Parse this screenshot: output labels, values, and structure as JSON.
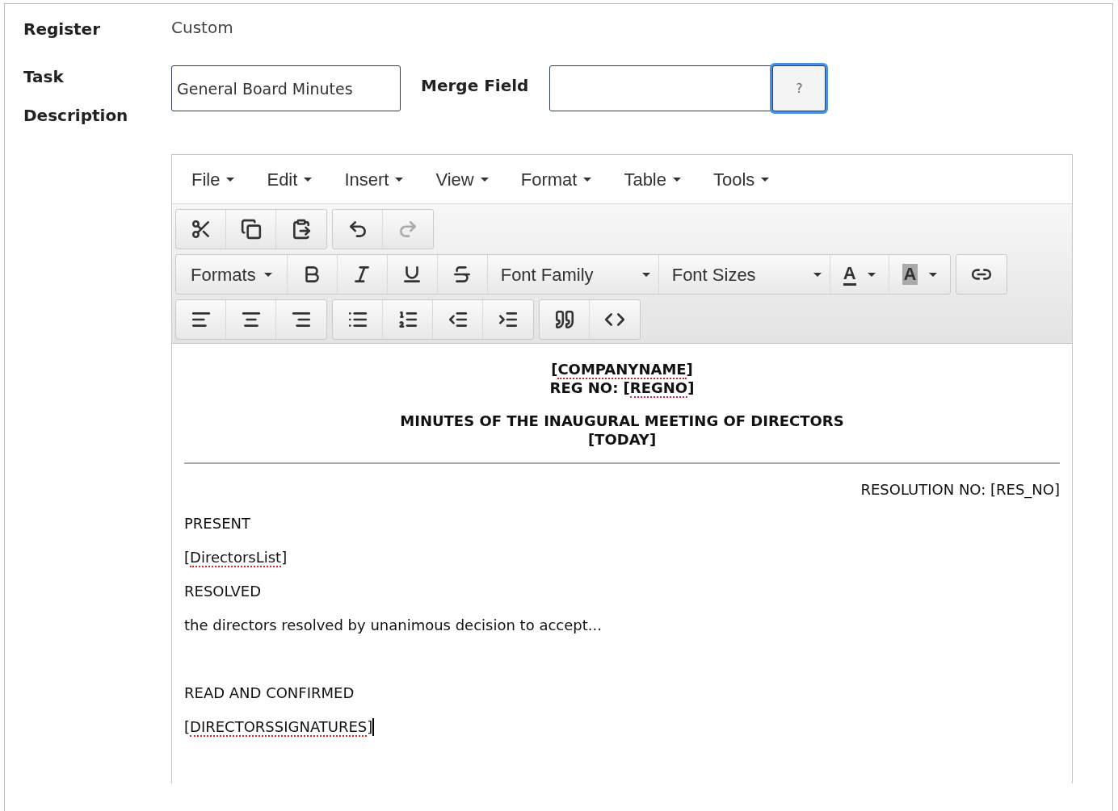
{
  "form": {
    "register_label": "Register",
    "register_value": "Custom",
    "task_label": "Task Description",
    "task_value": "General Board Minutes",
    "merge_label": "Merge Field",
    "merge_help": {
      "label": "?",
      "focused": true
    }
  },
  "editor": {
    "menus": [
      "File",
      "Edit",
      "Insert",
      "View",
      "Format",
      "Table",
      "Tools"
    ],
    "toolbar": [
      {
        "groups": [
          {
            "buttons": [
              {
                "kind": "icon",
                "disabled": false
              },
              {
                "kind": "icon",
                "disabled": false
              },
              {
                "kind": "icon",
                "disabled": false
              }
            ]
          },
          {
            "buttons": [
              {
                "kind": "icon",
                "disabled": false
              },
              {
                "kind": "icon",
                "disabled": true
              }
            ]
          }
        ]
      },
      {
        "groups": [
          {
            "buttons": [
              {
                "kind": "dropdown",
                "label": "Formats"
              },
              {
                "kind": "icon",
                "disabled": false
              },
              {
                "kind": "icon",
                "disabled": false
              },
              {
                "kind": "icon",
                "disabled": false
              },
              {
                "kind": "icon",
                "disabled": false
              },
              {
                "kind": "wide-dropdown",
                "label": "Font Family"
              },
              {
                "kind": "wide-dropdown",
                "label": "Font Sizes"
              },
              {
                "kind": "text-color",
                "label": "A"
              },
              {
                "kind": "highlight-color",
                "label": "A"
              }
            ]
          },
          {
            "buttons": [
              {
                "kind": "icon",
                "disabled": false
              }
            ]
          }
        ]
      },
      {
        "groups": [
          {
            "buttons": [
              {
                "kind": "icon",
                "disabled": false
              },
              {
                "kind": "icon",
                "disabled": false
              },
              {
                "kind": "icon",
                "disabled": false
              }
            ]
          },
          {
            "buttons": [
              {
                "kind": "icon",
                "disabled": false
              },
              {
                "kind": "icon",
                "disabled": false
              },
              {
                "kind": "icon",
                "disabled": false
              },
              {
                "kind": "icon",
                "disabled": false
              }
            ]
          },
          {
            "buttons": [
              {
                "kind": "icon",
                "disabled": false
              },
              {
                "kind": "icon",
                "disabled": false
              }
            ]
          }
        ]
      }
    ],
    "document": [
      {
        "kind": "heading",
        "segments": [
          {
            "text": "[",
            "flagged": false
          },
          {
            "text": "COMPANYNAME",
            "flagged": true
          },
          {
            "text": "]",
            "flagged": false
          }
        ]
      },
      {
        "kind": "heading",
        "segments": [
          {
            "text": "REG NO: [",
            "flagged": false
          },
          {
            "text": "REGNO",
            "flagged": true
          },
          {
            "text": "]",
            "flagged": false
          }
        ]
      },
      {
        "kind": "title",
        "segments": [
          {
            "text": "MINUTES OF THE INAUGURAL MEETING OF DIRECTORS",
            "flagged": false
          }
        ]
      },
      {
        "kind": "heading",
        "segments": [
          {
            "text": "[TODAY]",
            "flagged": false
          }
        ]
      },
      {
        "kind": "rule"
      },
      {
        "kind": "right",
        "segments": [
          {
            "text": "RESOLUTION NO: [RES_NO]",
            "flagged": false
          }
        ]
      },
      {
        "kind": "para",
        "segments": [
          {
            "text": "PRESENT",
            "flagged": false
          }
        ]
      },
      {
        "kind": "para",
        "segments": [
          {
            "text": "[",
            "flagged": false
          },
          {
            "text": "DirectorsList",
            "flagged": true
          },
          {
            "text": "]",
            "flagged": false
          }
        ]
      },
      {
        "kind": "para",
        "segments": [
          {
            "text": "RESOLVED",
            "flagged": false
          }
        ]
      },
      {
        "kind": "para",
        "segments": [
          {
            "text": "the directors resolved by unanimous decision to accept...",
            "flagged": false
          }
        ]
      },
      {
        "kind": "empty"
      },
      {
        "kind": "para",
        "segments": [
          {
            "text": "READ AND CONFIRMED",
            "flagged": false
          }
        ]
      },
      {
        "kind": "para",
        "caret": true,
        "segments": [
          {
            "text": "[",
            "flagged": false
          },
          {
            "text": "DIRECTORSSIGNATURES",
            "flagged": true
          },
          {
            "text": "]",
            "flagged": false
          }
        ]
      }
    ]
  }
}
